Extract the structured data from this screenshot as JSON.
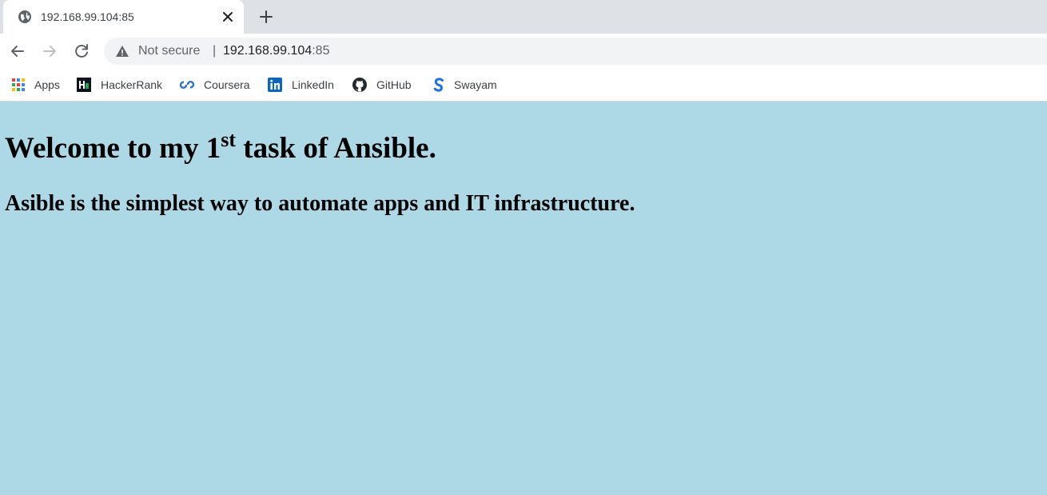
{
  "tab": {
    "title": "192.168.99.104:85",
    "favicon": "globe-icon"
  },
  "toolbar": {
    "security_label": "Not secure",
    "separator": "|",
    "url_host": "192.168.99.104",
    "url_port": ":85"
  },
  "bookmarks": [
    {
      "label": "Apps",
      "icon": "apps-grid-icon"
    },
    {
      "label": "HackerRank",
      "icon": "hackerrank-icon"
    },
    {
      "label": "Coursera",
      "icon": "coursera-icon"
    },
    {
      "label": "LinkedIn",
      "icon": "linkedin-icon"
    },
    {
      "label": "GitHub",
      "icon": "github-icon"
    },
    {
      "label": "Swayam",
      "icon": "swayam-icon"
    }
  ],
  "page": {
    "heading_before": "Welcome to my 1",
    "heading_sup": "st",
    "heading_after": " task of Ansible.",
    "subheading": "Asible is the simplest way to automate apps and IT infrastructure."
  },
  "colors": {
    "page_background": "#add8e6",
    "tabstrip": "#dee1e6",
    "omnibox": "#f1f3f4"
  }
}
